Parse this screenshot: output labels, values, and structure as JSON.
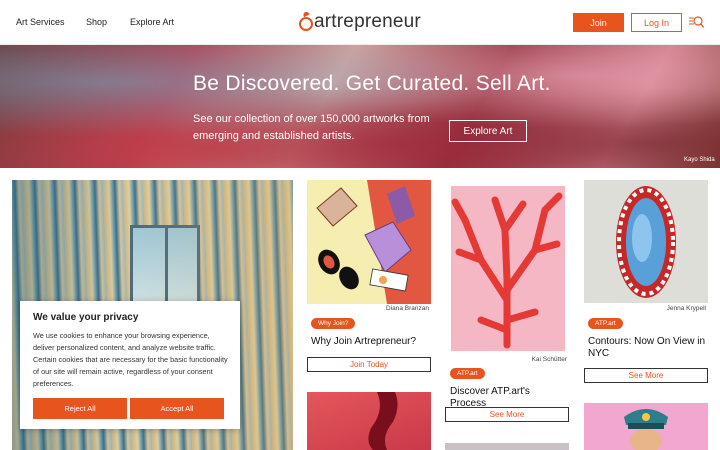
{
  "header": {
    "nav": [
      "Art Services",
      "Shop",
      "Explore Art"
    ],
    "logo_text": "artrepreneur",
    "join_label": "Join",
    "login_label": "Log In",
    "search_icon": "search-icon"
  },
  "hero": {
    "title": "Be Discovered. Get Curated. Sell Art.",
    "subtitle": "See our collection of over 150,000 artworks from emerging and established artists.",
    "button_label": "Explore Art",
    "credit": "Kayo Shida"
  },
  "cards": [
    {
      "credit": "Diana Branzan",
      "badge": "Why Join?",
      "title": "Why Join Artrepreneur?",
      "button": "Join Today"
    },
    {
      "credit": "Kai Schütter",
      "badge": "ATP.art",
      "title": "Discover ATP.art's Process",
      "button": "See More"
    },
    {
      "credit": "Jenna Krypell",
      "badge": "ATP.art",
      "title": "Contours: Now On View in NYC",
      "button": "See More"
    }
  ],
  "cookie": {
    "title": "We value your privacy",
    "text": "We use cookies to enhance your browsing experience, deliver personalized content, and analyze website traffic. Certain cookies that are necessary for the basic functionality of our site will remain active, regardless of your consent preferences.",
    "reject_label": "Reject All",
    "accept_label": "Accept All"
  },
  "colors": {
    "accent": "#e8541e"
  }
}
